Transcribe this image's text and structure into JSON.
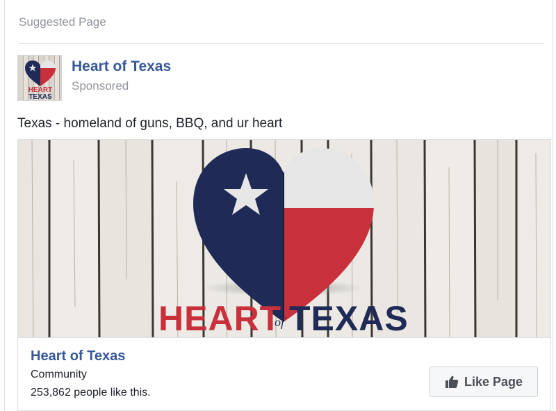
{
  "header": {
    "label": "Suggested Page"
  },
  "post": {
    "page_name": "Heart of Texas",
    "sponsored": "Sponsored",
    "text": "Texas - homeland of guns, BBQ, and ur heart",
    "image": {
      "logo_word1": "HEART",
      "logo_word2": "of",
      "logo_word3": "TEXAS",
      "avatar_word1": "HEART",
      "avatar_word2": "TEXAS"
    }
  },
  "link": {
    "title": "Heart of Texas",
    "category": "Community",
    "likes": "253,862 people like this.",
    "like_button": "Like Page"
  },
  "icons": {
    "like": "thumbs-up-icon"
  },
  "colors": {
    "link_blue": "#365899",
    "texas_blue": "#1f2a57",
    "texas_red": "#c8313b",
    "texas_white": "#e6e6e6"
  }
}
